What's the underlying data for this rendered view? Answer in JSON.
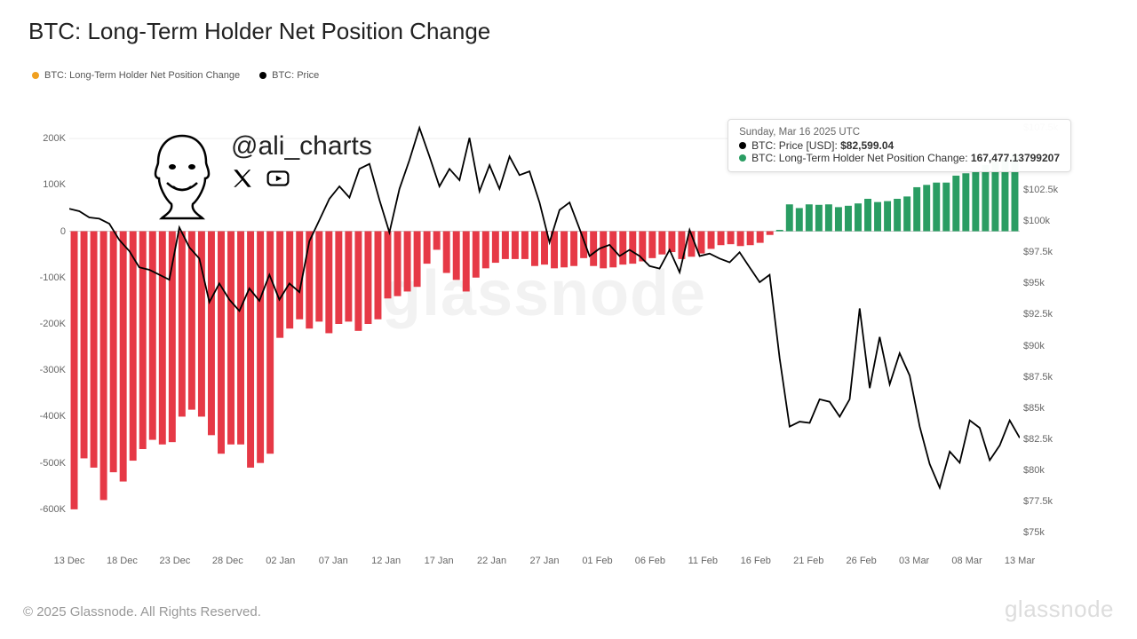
{
  "title": "BTC: Long-Term Holder Net Position Change",
  "legend": {
    "series1": "BTC: Long-Term Holder Net Position Change",
    "series2": "BTC: Price"
  },
  "handle": "@ali_charts",
  "watermark": "glassnode",
  "footer": "© 2025 Glassnode. All Rights Reserved.",
  "brand": "glassnode",
  "tooltip": {
    "date": "Sunday, Mar 16 2025 UTC",
    "price_label": "BTC: Price [USD]: ",
    "price_value": "$82,599.04",
    "lth_label": "BTC: Long-Term Holder Net Position Change: ",
    "lth_value": "167,477.13799207"
  },
  "chart_data": {
    "type": "bar+line",
    "y_left": {
      "label": "",
      "ticks": [
        "200K",
        "100K",
        "0",
        "-100K",
        "-200K",
        "-300K",
        "-400K",
        "-500K",
        "-600K"
      ],
      "range": [
        -650000,
        250000
      ]
    },
    "y_right": {
      "label": "",
      "ticks": [
        "$107.5k",
        "$105k",
        "$102.5k",
        "$100k",
        "$97.5k",
        "$95k",
        "$92.5k",
        "$90k",
        "$87.5k",
        "$85k",
        "$82.5k",
        "$80k",
        "$77.5k",
        "$75k"
      ],
      "range": [
        75000,
        108500
      ]
    },
    "x_ticks": [
      "13 Dec",
      "18 Dec",
      "23 Dec",
      "28 Dec",
      "02 Jan",
      "07 Jan",
      "12 Jan",
      "17 Jan",
      "22 Jan",
      "27 Jan",
      "01 Feb",
      "06 Feb",
      "11 Feb",
      "16 Feb",
      "21 Feb",
      "26 Feb",
      "03 Mar",
      "08 Mar",
      "13 Mar"
    ],
    "bars": [
      -600000,
      -490000,
      -510000,
      -580000,
      -520000,
      -540000,
      -495000,
      -470000,
      -450000,
      -460000,
      -455000,
      -400000,
      -385000,
      -400000,
      -440000,
      -480000,
      -460000,
      -460000,
      -510000,
      -500000,
      -480000,
      -230000,
      -210000,
      -190000,
      -210000,
      -195000,
      -220000,
      -200000,
      -195000,
      -215000,
      -200000,
      -190000,
      -145000,
      -140000,
      -130000,
      -120000,
      -70000,
      -40000,
      -90000,
      -105000,
      -130000,
      -100000,
      -80000,
      -68000,
      -60000,
      -60000,
      -60000,
      -75000,
      -72000,
      -80000,
      -78000,
      -75000,
      -58000,
      -75000,
      -80000,
      -78000,
      -72000,
      -70000,
      -65000,
      -58000,
      -50000,
      -45000,
      -60000,
      -55000,
      -48000,
      -38000,
      -30000,
      -28000,
      -32000,
      -30000,
      -25000,
      -8000,
      3000,
      58000,
      50000,
      58000,
      57000,
      58000,
      52000,
      55000,
      60000,
      70000,
      63000,
      65000,
      70000,
      75000,
      95000,
      100000,
      105000,
      105000,
      120000,
      125000,
      130000,
      143000,
      150000,
      155000,
      167000
    ],
    "price": [
      101000,
      100800,
      100300,
      100200,
      99800,
      98500,
      97600,
      96300,
      96100,
      95700,
      95300,
      99500,
      97900,
      97000,
      93500,
      95000,
      93700,
      92800,
      94600,
      93600,
      95700,
      93700,
      95000,
      94300,
      98400,
      100100,
      101800,
      102800,
      101900,
      104200,
      104600,
      101700,
      99100,
      102600,
      104900,
      107500,
      105200,
      102800,
      104200,
      103300,
      106700,
      102400,
      104500,
      102600,
      105200,
      103700,
      104000,
      101500,
      98300,
      100900,
      101500,
      99400,
      97200,
      97800,
      98100,
      97200,
      97700,
      97200,
      96400,
      96200,
      97700,
      95900,
      99300,
      97200,
      97400,
      97000,
      96700,
      97500,
      96300,
      95100,
      95700,
      89000,
      83500,
      83900,
      83800,
      85700,
      85500,
      84300,
      85700,
      93000,
      86600,
      90700,
      86900,
      89400,
      87600,
      83500,
      80500,
      78600,
      81500,
      80600,
      84000,
      83400,
      80800,
      82000,
      84000,
      82600
    ]
  }
}
